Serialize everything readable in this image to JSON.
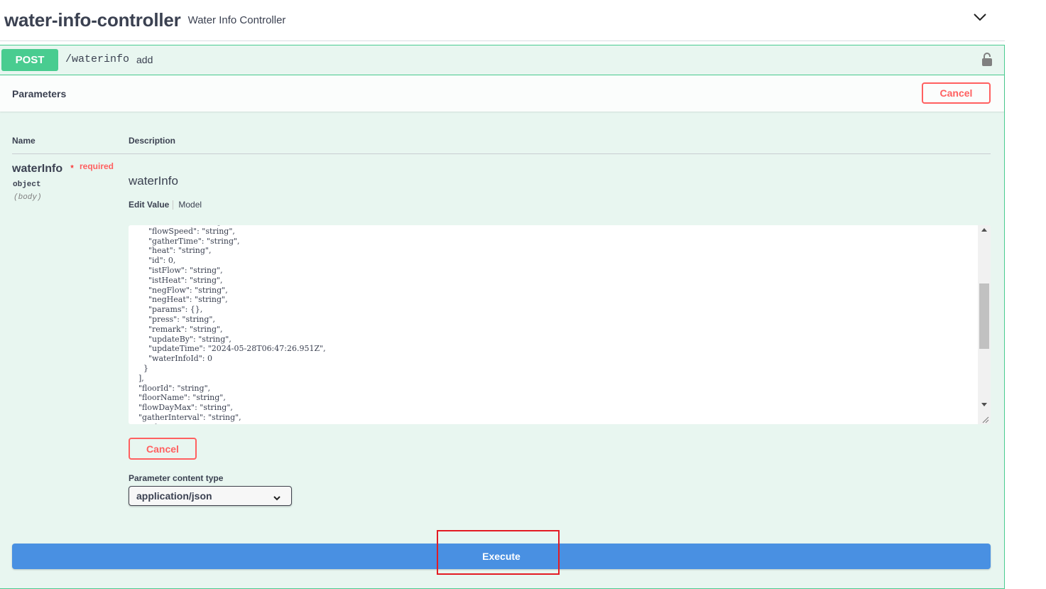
{
  "tag": {
    "name": "water-info-controller",
    "description": "Water Info Controller",
    "toggle_icon": "chevron-down-icon"
  },
  "operation": {
    "method": "POST",
    "path": "/waterinfo",
    "summary": "add",
    "lock_icon": "lock-icon",
    "method_color": "#49cc90"
  },
  "parameters": {
    "title": "Parameters",
    "cancel_label": "Cancel",
    "columns": {
      "name": "Name",
      "description": "Description"
    },
    "param": {
      "name": "waterInfo",
      "required_star": "*",
      "required_label": "required",
      "type": "object",
      "location": "(body)",
      "description": "waterInfo"
    },
    "tabs": {
      "edit_value": "Edit Value",
      "model": "Model"
    },
    "body_lines": [
      "        \"endFlow\": \"string\",",
      "        \"flowSpeed\": \"string\",",
      "        \"gatherTime\": \"string\",",
      "        \"heat\": \"string\",",
      "        \"id\": 0,",
      "        \"istFlow\": \"string\",",
      "        \"istHeat\": \"string\",",
      "        \"negFlow\": \"string\",",
      "        \"negHeat\": \"string\",",
      "        \"params\": {},",
      "        \"press\": \"string\",",
      "        \"remark\": \"string\",",
      "        \"updateBy\": \"string\",",
      "        \"updateTime\": \"2024-05-28T06:47:26.951Z\",",
      "        \"waterInfoId\": 0",
      "      }",
      "    ],",
      "    \"floorId\": \"string\",",
      "    \"floorName\": \"string\",",
      "    \"flowDayMax\": \"string\",",
      "    \"gatherInterval\": \"string\",",
      "    \"gatherTime\": \"string\","
    ],
    "editor_cancel_label": "Cancel",
    "content_type_label": "Parameter content type",
    "content_type_value": "application/json"
  },
  "execute_label": "Execute",
  "colors": {
    "execute": "#4990e2",
    "cancel": "#ff6060",
    "highlight": "#e31b23"
  }
}
